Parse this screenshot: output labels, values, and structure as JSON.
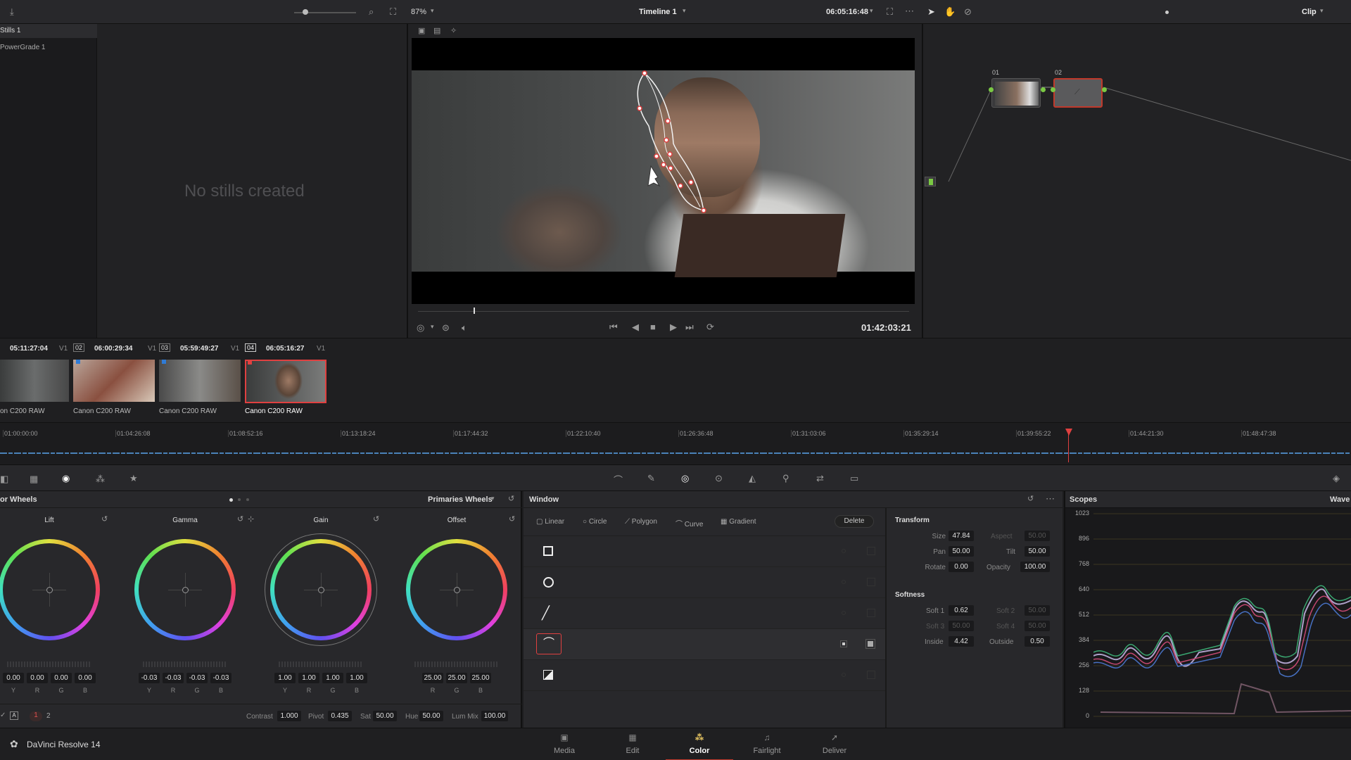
{
  "top_toolbar": {
    "zoom": "87%",
    "timeline_name": "Timeline 1",
    "timecode": "06:05:16:48",
    "mode": "Clip"
  },
  "gallery": {
    "albums": [
      "Stills 1",
      "PowerGrade 1"
    ],
    "empty_message": "No stills created"
  },
  "viewer": {
    "playhead_timecode": "01:42:03:21"
  },
  "node_editor": {
    "nodes": [
      {
        "label": "01"
      },
      {
        "label": "02"
      }
    ]
  },
  "clips": [
    {
      "index": "",
      "timecode": "05:11:27:04",
      "track": "V1",
      "name": "on C200 RAW",
      "flag": ""
    },
    {
      "index": "02",
      "timecode": "06:00:29:34",
      "track": "V1",
      "name": "Canon C200 RAW",
      "flag": "#2f7bd6"
    },
    {
      "index": "03",
      "timecode": "05:59:49:27",
      "track": "V1",
      "name": "Canon C200 RAW",
      "flag": "#2f7bd6"
    },
    {
      "index": "04",
      "timecode": "06:05:16:27",
      "track": "V1",
      "name": "Canon C200 RAW",
      "flag": "#e04040"
    }
  ],
  "ruler": [
    "01:00:00:00",
    "01:04:26:08",
    "01:08:52:16",
    "01:13:18:24",
    "01:17:44:32",
    "01:22:10:40",
    "01:26:36:48",
    "01:31:03:06",
    "01:35:29:14",
    "01:39:55:22",
    "01:44:21:30",
    "01:48:47:38"
  ],
  "color_wheels": {
    "title": "or Wheels",
    "mode": "Primaries Wheels",
    "wheels": [
      {
        "name": "Lift",
        "labels": [
          "Y",
          "R",
          "G",
          "B"
        ],
        "values": [
          "0.00",
          "0.00",
          "0.00",
          "0.00"
        ]
      },
      {
        "name": "Gamma",
        "labels": [
          "Y",
          "R",
          "G",
          "B"
        ],
        "values": [
          "-0.03",
          "-0.03",
          "-0.03",
          "-0.03"
        ]
      },
      {
        "name": "Gain",
        "labels": [
          "Y",
          "R",
          "G",
          "B"
        ],
        "values": [
          "1.00",
          "1.00",
          "1.00",
          "1.00"
        ]
      },
      {
        "name": "Offset",
        "labels": [
          "R",
          "G",
          "B"
        ],
        "values": [
          "25.00",
          "25.00",
          "25.00"
        ]
      }
    ],
    "pages": [
      "1",
      "2"
    ],
    "footer": {
      "contrast_label": "Contrast",
      "contrast": "1.000",
      "pivot_label": "Pivot",
      "pivot": "0.435",
      "sat_label": "Sat",
      "sat": "50.00",
      "hue_label": "Hue",
      "hue": "50.00",
      "lummix_label": "Lum Mix",
      "lummix": "100.00"
    }
  },
  "window_panel": {
    "title": "Window",
    "tools": [
      "Linear",
      "Circle",
      "Polygon",
      "Curve",
      "Gradient"
    ],
    "delete_label": "Delete"
  },
  "transform": {
    "title": "Transform",
    "size_label": "Size",
    "size": "47.84",
    "aspect_label": "Aspect",
    "aspect": "50.00",
    "pan_label": "Pan",
    "pan": "50.00",
    "tilt_label": "Tilt",
    "tilt": "50.00",
    "rotate_label": "Rotate",
    "rotate": "0.00",
    "opacity_label": "Opacity",
    "opacity": "100.00",
    "softness_title": "Softness",
    "soft1_label": "Soft 1",
    "soft1": "0.62",
    "soft2_label": "Soft 2",
    "soft2": "50.00",
    "soft3_label": "Soft 3",
    "soft3": "50.00",
    "soft4_label": "Soft 4",
    "soft4": "50.00",
    "inside_label": "Inside",
    "inside": "4.42",
    "outside_label": "Outside",
    "outside": "0.50"
  },
  "scopes": {
    "title": "Scopes",
    "mode": "Wave",
    "axis": [
      "1023",
      "896",
      "768",
      "640",
      "512",
      "384",
      "256",
      "128",
      "0"
    ]
  },
  "bottom_bar": {
    "app_name": "DaVinci Resolve 14",
    "pages": [
      "Media",
      "Edit",
      "Color",
      "Fairlight",
      "Deliver"
    ],
    "active_page": "Color"
  },
  "colors": {
    "accent": "#e04040",
    "active_tab": "#c0392b"
  }
}
